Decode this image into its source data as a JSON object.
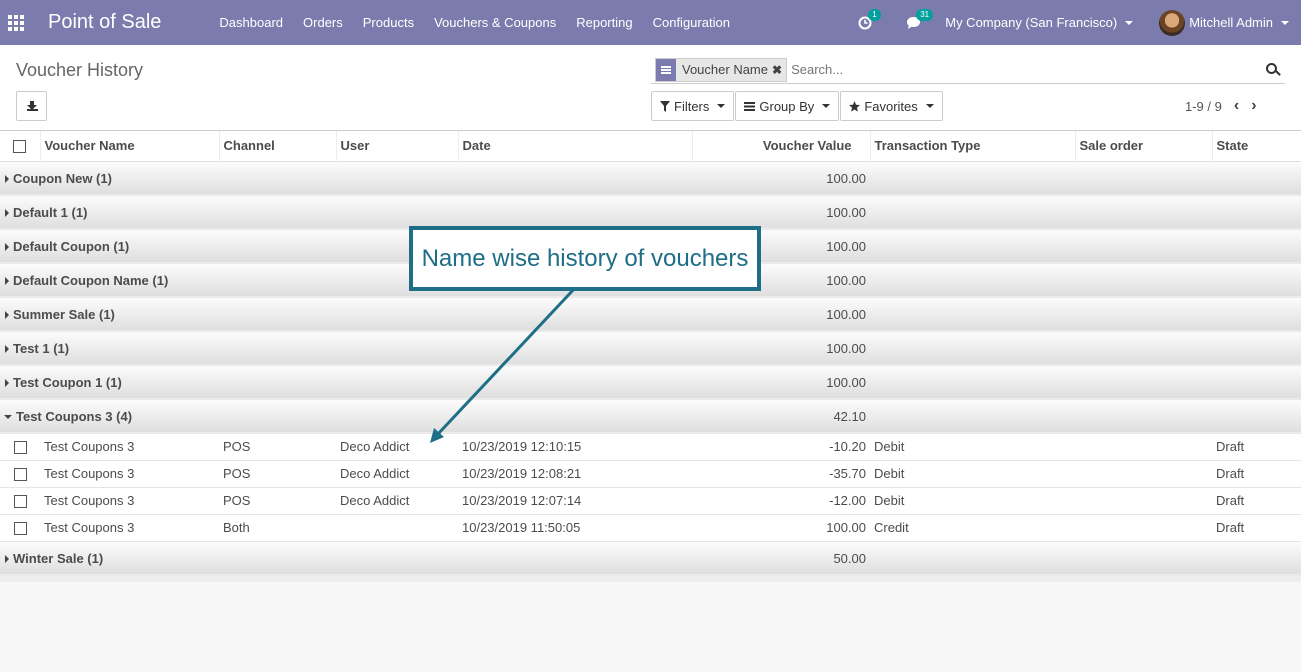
{
  "navbar": {
    "app_title": "Point of Sale",
    "menu": [
      "Dashboard",
      "Orders",
      "Products",
      "Vouchers & Coupons",
      "Reporting",
      "Configuration"
    ],
    "activity_badge": "1",
    "messages_badge": "31",
    "company": "My Company (San Francisco)",
    "user": "Mitchell Admin",
    "bar_color": "#7c7bad"
  },
  "control_panel": {
    "breadcrumb": "Voucher History",
    "facet_label": "Voucher Name",
    "search_placeholder": "Search...",
    "filters_label": "Filters",
    "groupby_label": "Group By",
    "favorites_label": "Favorites",
    "pager": "1-9 / 9"
  },
  "list": {
    "columns": [
      "Voucher Name",
      "Channel",
      "User",
      "Date",
      "Voucher Value",
      "Transaction Type",
      "Sale order",
      "State"
    ],
    "groups_before": [
      {
        "name": "Coupon New (1)",
        "value": "100.00"
      },
      {
        "name": "Default 1 (1)",
        "value": "100.00"
      },
      {
        "name": "Default Coupon (1)",
        "value": "100.00"
      },
      {
        "name": "Default Coupon Name (1)",
        "value": "100.00"
      },
      {
        "name": "Summer Sale (1)",
        "value": "100.00"
      },
      {
        "name": "Test 1 (1)",
        "value": "100.00"
      },
      {
        "name": "Test Coupon 1 (1)",
        "value": "100.00"
      }
    ],
    "expanded_group": {
      "name": "Test Coupons 3 (4)",
      "value": "42.10"
    },
    "records": [
      {
        "name": "Test Coupons 3",
        "channel": "POS",
        "user": "Deco Addict",
        "date": "10/23/2019 12:10:15",
        "value": "-10.20",
        "type": "Debit",
        "sale_order": "",
        "state": "Draft"
      },
      {
        "name": "Test Coupons 3",
        "channel": "POS",
        "user": "Deco Addict",
        "date": "10/23/2019 12:08:21",
        "value": "-35.70",
        "type": "Debit",
        "sale_order": "",
        "state": "Draft"
      },
      {
        "name": "Test Coupons 3",
        "channel": "POS",
        "user": "Deco Addict",
        "date": "10/23/2019 12:07:14",
        "value": "-12.00",
        "type": "Debit",
        "sale_order": "",
        "state": "Draft"
      },
      {
        "name": "Test Coupons 3",
        "channel": "Both",
        "user": "",
        "date": "10/23/2019 11:50:05",
        "value": "100.00",
        "type": "Credit",
        "sale_order": "",
        "state": "Draft"
      }
    ],
    "groups_after": [
      {
        "name": "Winter Sale (1)",
        "value": "50.00"
      }
    ]
  },
  "annotation": {
    "text": "Name wise history of vouchers",
    "color": "#1d6e86"
  }
}
